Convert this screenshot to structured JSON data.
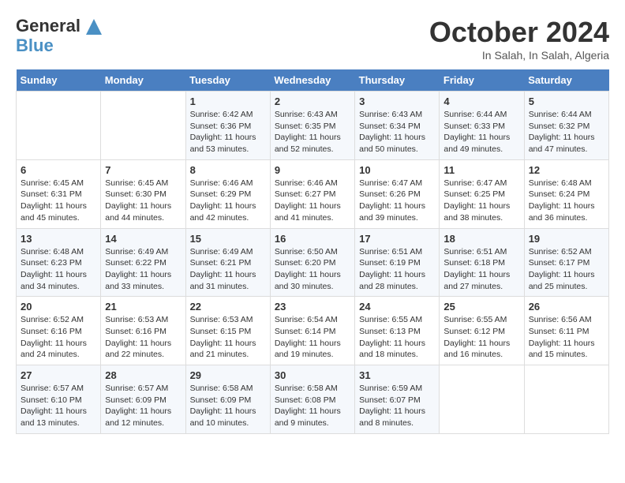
{
  "header": {
    "logo_line1": "General",
    "logo_line2": "Blue",
    "month": "October 2024",
    "location": "In Salah, In Salah, Algeria"
  },
  "weekdays": [
    "Sunday",
    "Monday",
    "Tuesday",
    "Wednesday",
    "Thursday",
    "Friday",
    "Saturday"
  ],
  "weeks": [
    [
      {
        "day": "",
        "sunrise": "",
        "sunset": "",
        "daylight": ""
      },
      {
        "day": "",
        "sunrise": "",
        "sunset": "",
        "daylight": ""
      },
      {
        "day": "1",
        "sunrise": "Sunrise: 6:42 AM",
        "sunset": "Sunset: 6:36 PM",
        "daylight": "Daylight: 11 hours and 53 minutes."
      },
      {
        "day": "2",
        "sunrise": "Sunrise: 6:43 AM",
        "sunset": "Sunset: 6:35 PM",
        "daylight": "Daylight: 11 hours and 52 minutes."
      },
      {
        "day": "3",
        "sunrise": "Sunrise: 6:43 AM",
        "sunset": "Sunset: 6:34 PM",
        "daylight": "Daylight: 11 hours and 50 minutes."
      },
      {
        "day": "4",
        "sunrise": "Sunrise: 6:44 AM",
        "sunset": "Sunset: 6:33 PM",
        "daylight": "Daylight: 11 hours and 49 minutes."
      },
      {
        "day": "5",
        "sunrise": "Sunrise: 6:44 AM",
        "sunset": "Sunset: 6:32 PM",
        "daylight": "Daylight: 11 hours and 47 minutes."
      }
    ],
    [
      {
        "day": "6",
        "sunrise": "Sunrise: 6:45 AM",
        "sunset": "Sunset: 6:31 PM",
        "daylight": "Daylight: 11 hours and 45 minutes."
      },
      {
        "day": "7",
        "sunrise": "Sunrise: 6:45 AM",
        "sunset": "Sunset: 6:30 PM",
        "daylight": "Daylight: 11 hours and 44 minutes."
      },
      {
        "day": "8",
        "sunrise": "Sunrise: 6:46 AM",
        "sunset": "Sunset: 6:29 PM",
        "daylight": "Daylight: 11 hours and 42 minutes."
      },
      {
        "day": "9",
        "sunrise": "Sunrise: 6:46 AM",
        "sunset": "Sunset: 6:27 PM",
        "daylight": "Daylight: 11 hours and 41 minutes."
      },
      {
        "day": "10",
        "sunrise": "Sunrise: 6:47 AM",
        "sunset": "Sunset: 6:26 PM",
        "daylight": "Daylight: 11 hours and 39 minutes."
      },
      {
        "day": "11",
        "sunrise": "Sunrise: 6:47 AM",
        "sunset": "Sunset: 6:25 PM",
        "daylight": "Daylight: 11 hours and 38 minutes."
      },
      {
        "day": "12",
        "sunrise": "Sunrise: 6:48 AM",
        "sunset": "Sunset: 6:24 PM",
        "daylight": "Daylight: 11 hours and 36 minutes."
      }
    ],
    [
      {
        "day": "13",
        "sunrise": "Sunrise: 6:48 AM",
        "sunset": "Sunset: 6:23 PM",
        "daylight": "Daylight: 11 hours and 34 minutes."
      },
      {
        "day": "14",
        "sunrise": "Sunrise: 6:49 AM",
        "sunset": "Sunset: 6:22 PM",
        "daylight": "Daylight: 11 hours and 33 minutes."
      },
      {
        "day": "15",
        "sunrise": "Sunrise: 6:49 AM",
        "sunset": "Sunset: 6:21 PM",
        "daylight": "Daylight: 11 hours and 31 minutes."
      },
      {
        "day": "16",
        "sunrise": "Sunrise: 6:50 AM",
        "sunset": "Sunset: 6:20 PM",
        "daylight": "Daylight: 11 hours and 30 minutes."
      },
      {
        "day": "17",
        "sunrise": "Sunrise: 6:51 AM",
        "sunset": "Sunset: 6:19 PM",
        "daylight": "Daylight: 11 hours and 28 minutes."
      },
      {
        "day": "18",
        "sunrise": "Sunrise: 6:51 AM",
        "sunset": "Sunset: 6:18 PM",
        "daylight": "Daylight: 11 hours and 27 minutes."
      },
      {
        "day": "19",
        "sunrise": "Sunrise: 6:52 AM",
        "sunset": "Sunset: 6:17 PM",
        "daylight": "Daylight: 11 hours and 25 minutes."
      }
    ],
    [
      {
        "day": "20",
        "sunrise": "Sunrise: 6:52 AM",
        "sunset": "Sunset: 6:16 PM",
        "daylight": "Daylight: 11 hours and 24 minutes."
      },
      {
        "day": "21",
        "sunrise": "Sunrise: 6:53 AM",
        "sunset": "Sunset: 6:16 PM",
        "daylight": "Daylight: 11 hours and 22 minutes."
      },
      {
        "day": "22",
        "sunrise": "Sunrise: 6:53 AM",
        "sunset": "Sunset: 6:15 PM",
        "daylight": "Daylight: 11 hours and 21 minutes."
      },
      {
        "day": "23",
        "sunrise": "Sunrise: 6:54 AM",
        "sunset": "Sunset: 6:14 PM",
        "daylight": "Daylight: 11 hours and 19 minutes."
      },
      {
        "day": "24",
        "sunrise": "Sunrise: 6:55 AM",
        "sunset": "Sunset: 6:13 PM",
        "daylight": "Daylight: 11 hours and 18 minutes."
      },
      {
        "day": "25",
        "sunrise": "Sunrise: 6:55 AM",
        "sunset": "Sunset: 6:12 PM",
        "daylight": "Daylight: 11 hours and 16 minutes."
      },
      {
        "day": "26",
        "sunrise": "Sunrise: 6:56 AM",
        "sunset": "Sunset: 6:11 PM",
        "daylight": "Daylight: 11 hours and 15 minutes."
      }
    ],
    [
      {
        "day": "27",
        "sunrise": "Sunrise: 6:57 AM",
        "sunset": "Sunset: 6:10 PM",
        "daylight": "Daylight: 11 hours and 13 minutes."
      },
      {
        "day": "28",
        "sunrise": "Sunrise: 6:57 AM",
        "sunset": "Sunset: 6:09 PM",
        "daylight": "Daylight: 11 hours and 12 minutes."
      },
      {
        "day": "29",
        "sunrise": "Sunrise: 6:58 AM",
        "sunset": "Sunset: 6:09 PM",
        "daylight": "Daylight: 11 hours and 10 minutes."
      },
      {
        "day": "30",
        "sunrise": "Sunrise: 6:58 AM",
        "sunset": "Sunset: 6:08 PM",
        "daylight": "Daylight: 11 hours and 9 minutes."
      },
      {
        "day": "31",
        "sunrise": "Sunrise: 6:59 AM",
        "sunset": "Sunset: 6:07 PM",
        "daylight": "Daylight: 11 hours and 8 minutes."
      },
      {
        "day": "",
        "sunrise": "",
        "sunset": "",
        "daylight": ""
      },
      {
        "day": "",
        "sunrise": "",
        "sunset": "",
        "daylight": ""
      }
    ]
  ]
}
